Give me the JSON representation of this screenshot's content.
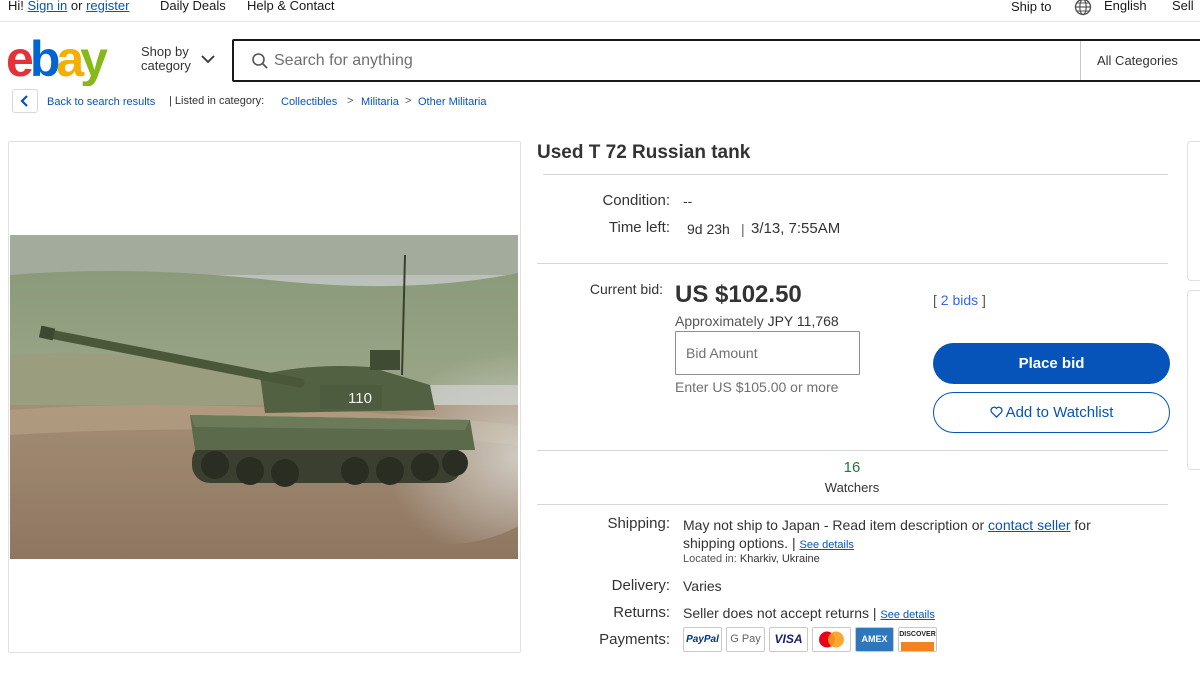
{
  "topbar": {
    "greeting": "Hi!",
    "sign_in": "Sign in",
    "or": "or",
    "register": "register",
    "daily_deals": "Daily Deals",
    "help_contact": "Help & Contact",
    "ship_to": "Ship to",
    "language": "English",
    "sell": "Sell"
  },
  "header": {
    "logo_colors": [
      "#e53238",
      "#0064d2",
      "#f5af02",
      "#86b817"
    ],
    "shop_by_line1": "Shop by",
    "shop_by_line2": "category",
    "search_placeholder": "Search for anything",
    "category": "All Categories"
  },
  "breadcrumb": {
    "back": "Back to search results",
    "listed_in": "| Listed in category:",
    "items": [
      "Collectibles",
      "Militaria",
      "Other Militaria"
    ],
    "separator": ">"
  },
  "item": {
    "title": "Used T 72 Russian tank",
    "condition_label": "Condition:",
    "condition_value": "--",
    "time_left_label": "Time left:",
    "time_left_value": "9d 23h",
    "time_sep": "|",
    "end_time": "3/13, 7:55AM",
    "current_bid_label": "Current bid:",
    "current_bid": "US $102.50",
    "approx_label": "Approximately",
    "approx_value": "JPY 11,768",
    "bids_open": "[",
    "bids": "2 bids",
    "bids_close": "]",
    "bid_placeholder": "Bid Amount",
    "bid_hint": "Enter US $105.00 or more",
    "place_bid": "Place bid",
    "add_watchlist": "Add to Watchlist",
    "watchers_count": "16",
    "watchers_label": "Watchers",
    "tank_marking": "110"
  },
  "shipping": {
    "label": "Shipping:",
    "text1": "May not ship to Japan - Read item description or",
    "contact_seller": "contact seller",
    "text2": "for",
    "text3": "shipping options. |",
    "see_details": "See details",
    "located_label": "Located in:",
    "located_value": "Kharkiv, Ukraine"
  },
  "delivery": {
    "label": "Delivery:",
    "value": "Varies"
  },
  "returns": {
    "label": "Returns:",
    "value": "Seller does not accept returns |",
    "see_details": "See details"
  },
  "payments": {
    "label": "Payments:",
    "methods": [
      "PayPal",
      "G Pay",
      "VISA",
      "MasterCard",
      "AMEX",
      "DISCOVER"
    ]
  }
}
